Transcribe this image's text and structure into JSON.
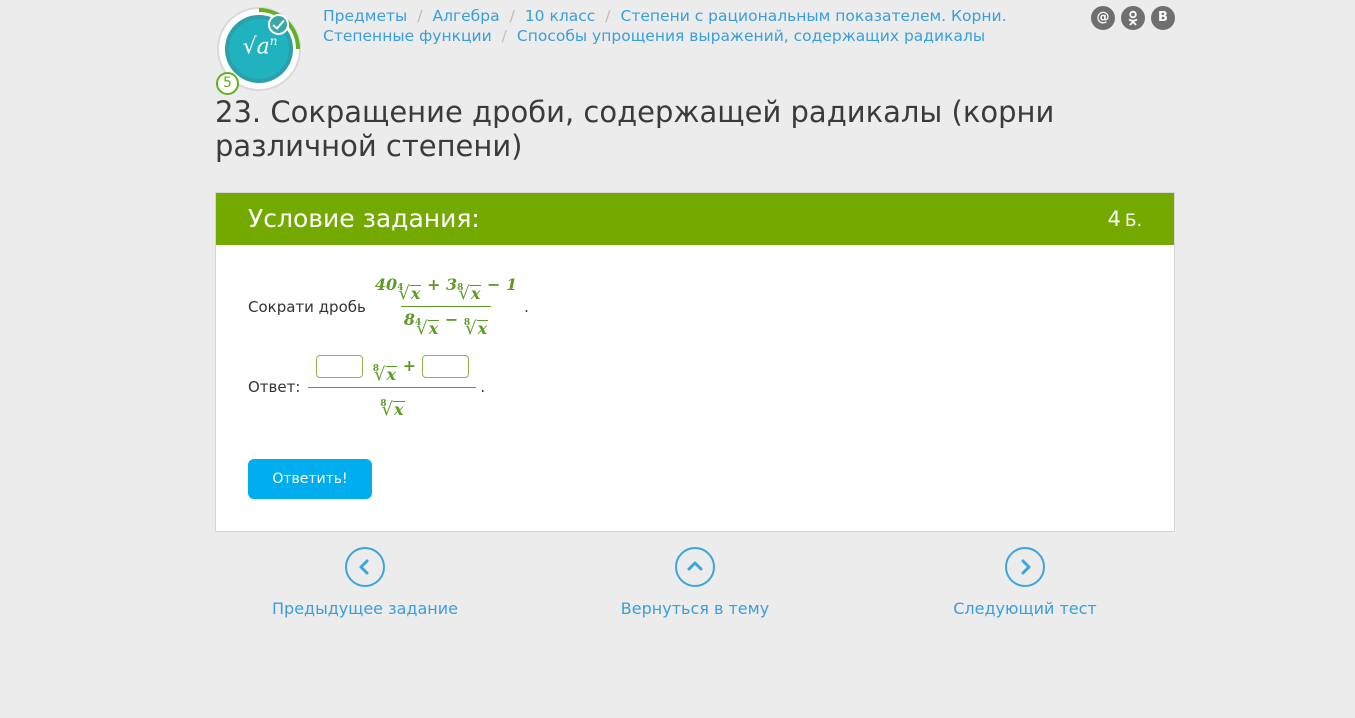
{
  "logo": {
    "symbol": "√a",
    "exponent": "n",
    "level": "5"
  },
  "breadcrumbs": [
    "Предметы",
    "Алгебра",
    "10 класс",
    "Степени с рациональным показателем. Корни. Степенные функции",
    "Способы упрощения выражений, содержащих радикалы"
  ],
  "social": [
    "@",
    "ok",
    "В"
  ],
  "page_title": "23. Сокращение дроби, содержащей радикалы (корни различной степени)",
  "task": {
    "header": "Условие задания:",
    "points": "4",
    "points_unit": "Б.",
    "prompt": "Сократи дробь",
    "fraction": {
      "num_coef1": "40",
      "num_root1_index": "4",
      "num_var": "x",
      "num_plus": "+",
      "num_coef2": "3",
      "num_root2_index": "8",
      "num_minus": "−",
      "num_const": "1",
      "den_coef": "8",
      "den_root1_index": "4",
      "den_minus": "−",
      "den_root2_index": "8"
    },
    "answer_label": "Ответ:",
    "answer": {
      "root_index": "8",
      "var": "x",
      "plus": "+",
      "box1_value": "",
      "box2_value": ""
    },
    "submit_label": "Ответить!"
  },
  "navigation": {
    "prev_label": "Предыдущее задание",
    "up_label": "Вернуться в тему",
    "next_label": "Следующий тест"
  },
  "colors": {
    "header_green": "#74aa00",
    "link_blue": "#3a9edb",
    "button_blue": "#00aeef",
    "math_green": "#5e9a26"
  }
}
